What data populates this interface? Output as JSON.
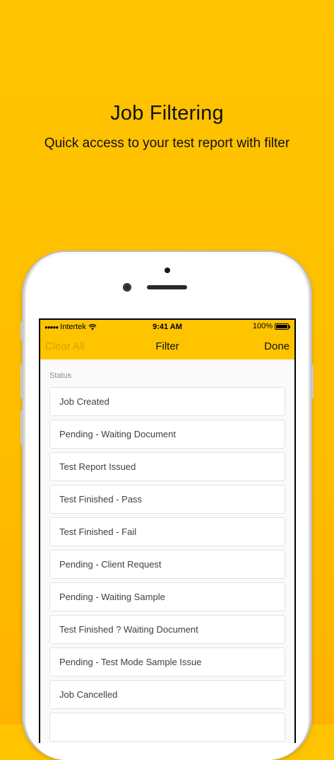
{
  "promo": {
    "title": "Job Filtering",
    "subtitle": "Quick access to your test report with filter"
  },
  "status_bar": {
    "carrier": "Intertek",
    "time": "9:41 AM",
    "battery": "100%"
  },
  "nav": {
    "left_label": "Clear All",
    "title": "Filter",
    "right_label": "Done"
  },
  "filter": {
    "section_label": "Status",
    "items": [
      {
        "label": "Job Created"
      },
      {
        "label": "Pending - Waiting Document"
      },
      {
        "label": "Test Report Issued"
      },
      {
        "label": "Test Finished - Pass"
      },
      {
        "label": "Test Finished - Fail"
      },
      {
        "label": "Pending - Client Request"
      },
      {
        "label": "Pending - Waiting Sample"
      },
      {
        "label": "Test Finished ? Waiting Document"
      },
      {
        "label": "Pending - Test Mode Sample Issue"
      },
      {
        "label": "Job Cancelled"
      },
      {
        "label": ""
      }
    ]
  },
  "colors": {
    "accent": "#ffc400",
    "disabled_text": "#d9a200"
  },
  "icons": {
    "signal": "signal-dots-icon",
    "wifi": "wifi-icon",
    "battery": "battery-icon"
  }
}
